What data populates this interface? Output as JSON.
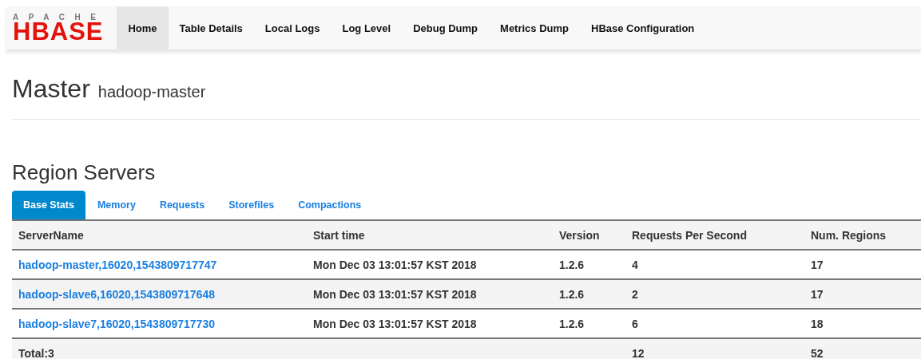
{
  "logo": {
    "top": "APACHE",
    "main": "HBASE"
  },
  "nav": [
    {
      "label": "Home",
      "selected": true
    },
    {
      "label": "Table Details",
      "selected": false
    },
    {
      "label": "Local Logs",
      "selected": false
    },
    {
      "label": "Log Level",
      "selected": false
    },
    {
      "label": "Debug Dump",
      "selected": false
    },
    {
      "label": "Metrics Dump",
      "selected": false
    },
    {
      "label": "HBase Configuration",
      "selected": false
    }
  ],
  "page_title": {
    "main": "Master",
    "sub": "hadoop-master"
  },
  "section_title": "Region Servers",
  "tabs": [
    {
      "label": "Base Stats",
      "selected": true
    },
    {
      "label": "Memory",
      "selected": false
    },
    {
      "label": "Requests",
      "selected": false
    },
    {
      "label": "Storefiles",
      "selected": false
    },
    {
      "label": "Compactions",
      "selected": false
    }
  ],
  "table": {
    "columns": [
      "ServerName",
      "Start time",
      "Version",
      "Requests Per Second",
      "Num. Regions"
    ],
    "rows": [
      {
        "server": "hadoop-master,16020,1543809717747",
        "start": "Mon Dec 03 13:01:57 KST 2018",
        "version": "1.2.6",
        "requests": "4",
        "regions": "17"
      },
      {
        "server": "hadoop-slave6,16020,1543809717648",
        "start": "Mon Dec 03 13:01:57 KST 2018",
        "version": "1.2.6",
        "requests": "2",
        "regions": "17"
      },
      {
        "server": "hadoop-slave7,16020,1543809717730",
        "start": "Mon Dec 03 13:01:57 KST 2018",
        "version": "1.2.6",
        "requests": "6",
        "regions": "18"
      }
    ],
    "total": {
      "label": "Total:3",
      "requests": "12",
      "regions": "52"
    }
  }
}
